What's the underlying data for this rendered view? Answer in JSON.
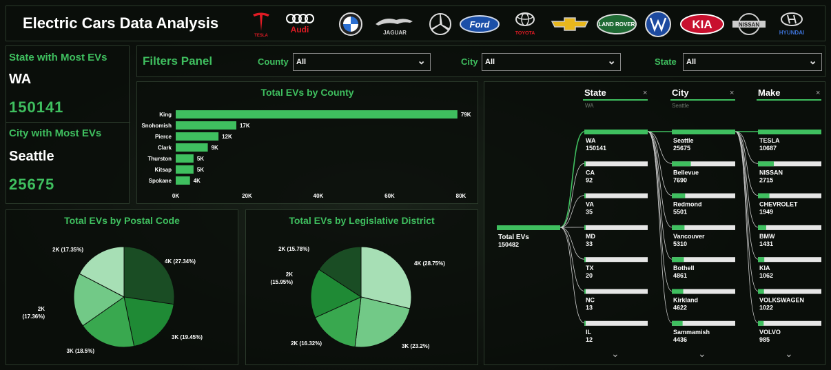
{
  "header": {
    "title": "Electric Cars Data Analysis",
    "brands": [
      "TESLA",
      "Audi",
      "BMW",
      "JAGUAR",
      "Mercedes",
      "Ford",
      "TOYOTA",
      "Chevrolet",
      "LAND ROVER",
      "VW",
      "KIA",
      "NISSAN",
      "HYUNDAI"
    ]
  },
  "kpis": {
    "state_title": "State with Most EVs",
    "state_name": "WA",
    "state_value": "150141",
    "city_title": "City with Most EVs",
    "city_name": "Seattle",
    "city_value": "25675"
  },
  "filters": {
    "title": "Filters Panel",
    "county_label": "County",
    "county_value": "All",
    "city_label": "City",
    "city_value": "All",
    "state_label": "State",
    "state_value": "All"
  },
  "county_chart": {
    "title": "Total EVs by County"
  },
  "postal_chart": {
    "title": "Total EVs by Postal Code"
  },
  "district_chart": {
    "title": "Total EVs by Legislative District"
  },
  "tree": {
    "root_label": "Total EVs",
    "root_value": "150482",
    "columns": [
      {
        "head": "State",
        "sub": "WA"
      },
      {
        "head": "City",
        "sub": "Seattle"
      },
      {
        "head": "Make",
        "sub": ""
      }
    ],
    "close_glyph": "×",
    "more_glyph": "⌄",
    "state_nodes": [
      {
        "label": "WA",
        "value": "150141",
        "frac": 1.0
      },
      {
        "label": "CA",
        "value": "92",
        "frac": 0.01
      },
      {
        "label": "VA",
        "value": "35",
        "frac": 0.005
      },
      {
        "label": "MD",
        "value": "33",
        "frac": 0.005
      },
      {
        "label": "TX",
        "value": "20",
        "frac": 0.004
      },
      {
        "label": "NC",
        "value": "13",
        "frac": 0.003
      },
      {
        "label": "IL",
        "value": "12",
        "frac": 0.003
      }
    ],
    "city_nodes": [
      {
        "label": "Seattle",
        "value": "25675",
        "frac": 1.0
      },
      {
        "label": "Bellevue",
        "value": "7690",
        "frac": 0.3
      },
      {
        "label": "Redmond",
        "value": "5501",
        "frac": 0.21
      },
      {
        "label": "Vancouver",
        "value": "5310",
        "frac": 0.2
      },
      {
        "label": "Bothell",
        "value": "4861",
        "frac": 0.19
      },
      {
        "label": "Kirkland",
        "value": "4622",
        "frac": 0.18
      },
      {
        "label": "Sammamish",
        "value": "4436",
        "frac": 0.17
      }
    ],
    "make_nodes": [
      {
        "label": "TESLA",
        "value": "10687",
        "frac": 1.0
      },
      {
        "label": "NISSAN",
        "value": "2715",
        "frac": 0.25
      },
      {
        "label": "CHEVROLET",
        "value": "1949",
        "frac": 0.18
      },
      {
        "label": "BMW",
        "value": "1431",
        "frac": 0.13
      },
      {
        "label": "KIA",
        "value": "1062",
        "frac": 0.1
      },
      {
        "label": "VOLKSWAGEN",
        "value": "1022",
        "frac": 0.095
      },
      {
        "label": "VOLVO",
        "value": "985",
        "frac": 0.09
      }
    ]
  },
  "colors": {
    "accent": "#3fbf5f",
    "bar": "#3fbf5f",
    "pie": [
      "#1a4d24",
      "#1f8a35",
      "#39a84f",
      "#72c987",
      "#a7dfb5"
    ]
  },
  "chart_data": [
    {
      "type": "bar",
      "title": "Total EVs by County",
      "categories": [
        "King",
        "Snohomish",
        "Pierce",
        "Clark",
        "Thurston",
        "Kitsap",
        "Spokane"
      ],
      "values": [
        79000,
        17000,
        12000,
        9000,
        5000,
        5000,
        4000
      ],
      "data_labels": [
        "79K",
        "17K",
        "12K",
        "9K",
        "5K",
        "5K",
        "4K"
      ],
      "xticks": [
        "0K",
        "20K",
        "40K",
        "60K",
        "80K"
      ],
      "xlim": [
        0,
        80000
      ],
      "orientation": "horizontal"
    },
    {
      "type": "pie",
      "title": "Total EVs by Postal Code",
      "slices": [
        {
          "label": "4K (27.34%)",
          "value": 27.34
        },
        {
          "label": "3K (19.45%)",
          "value": 19.45
        },
        {
          "label": "3K (18.5%)",
          "value": 18.5
        },
        {
          "label": "2K (17.36%)",
          "value": 17.36
        },
        {
          "label": "2K (17.35%)",
          "value": 17.35
        }
      ]
    },
    {
      "type": "pie",
      "title": "Total EVs by Legislative District",
      "slices": [
        {
          "label": "4K (28.75%)",
          "value": 28.75
        },
        {
          "label": "3K (23.2%)",
          "value": 23.2
        },
        {
          "label": "2K (16.32%)",
          "value": 16.32
        },
        {
          "label": "2K (15.95%)",
          "value": 15.95
        },
        {
          "label": "2K (15.78%)",
          "value": 15.78
        }
      ]
    }
  ]
}
